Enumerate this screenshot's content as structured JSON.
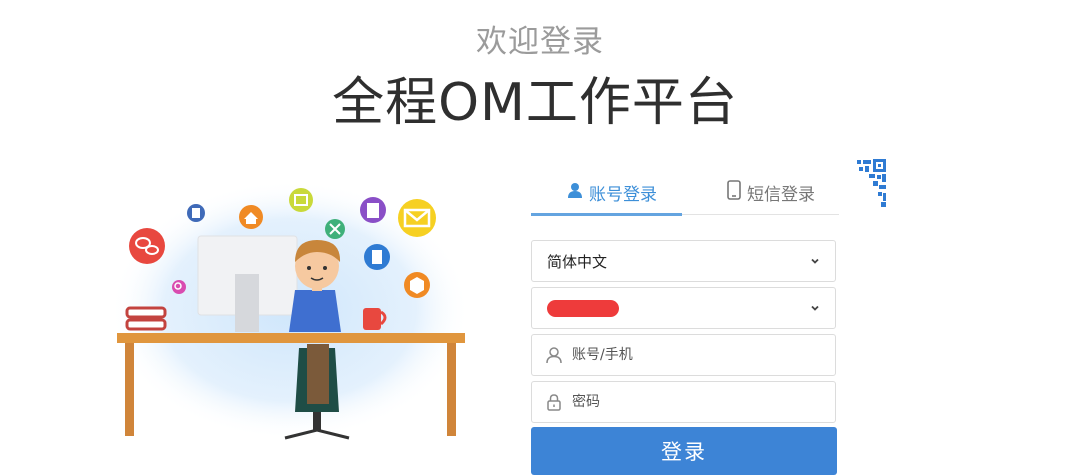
{
  "header": {
    "welcome": "欢迎登录",
    "title": "全程OM工作平台"
  },
  "tabs": [
    {
      "label": "账号登录",
      "icon": "user-icon",
      "active": true
    },
    {
      "label": "短信登录",
      "icon": "phone-icon",
      "active": false
    }
  ],
  "qr": {
    "icon": "qr-code-icon"
  },
  "form": {
    "language": {
      "value": "简体中文",
      "icon": "chevron-down-icon"
    },
    "organization": {
      "value": "",
      "redacted": true,
      "redaction_color": "#ee3b3b",
      "icon": "chevron-down-icon"
    },
    "username": {
      "placeholder": "账号/手机",
      "icon": "user-outline-icon"
    },
    "password": {
      "placeholder": "密码",
      "icon": "lock-icon"
    },
    "submit_label": "登录"
  },
  "illustration": {
    "subject": "person-at-desk-illustration",
    "icons": [
      "chat-icon",
      "calculator-icon",
      "home-icon",
      "book-icon",
      "wrench-icon",
      "document-icon",
      "mail-icon",
      "search-icon",
      "file-icon",
      "box-icon"
    ]
  },
  "colors": {
    "accent": "#3d84d6",
    "tab_active": "#3d8fd8",
    "title": "#2f2f2f",
    "subtitle": "#9b9b9b"
  }
}
